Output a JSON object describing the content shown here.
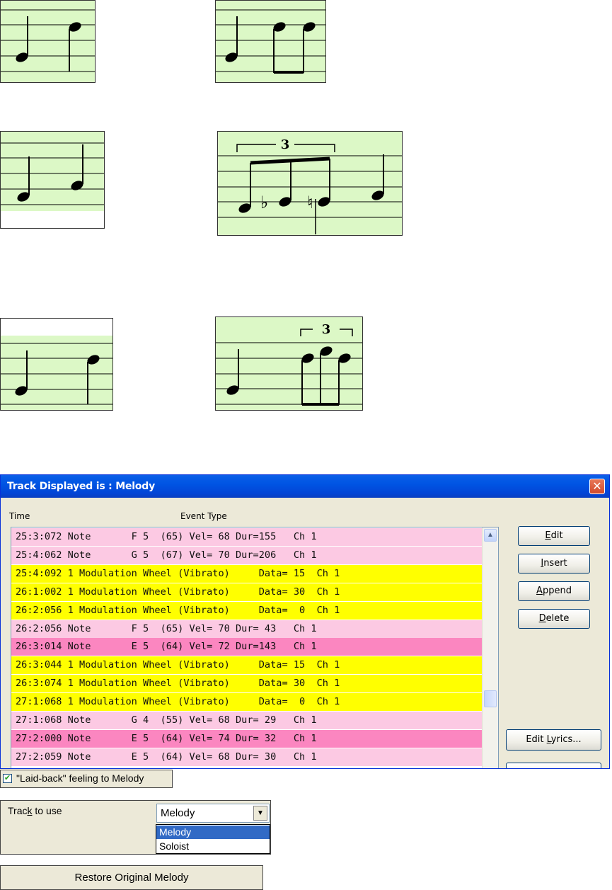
{
  "dialog": {
    "title": "Track Displayed is : Melody",
    "close_glyph": "✕",
    "headers": {
      "time": "Time",
      "event_type": "Event Type"
    },
    "rows": [
      {
        "text": "25:3:072 Note       F 5  (65) Vel= 68 Dur=155   Ch 1",
        "color": "#fcc9e3"
      },
      {
        "text": "25:4:062 Note       G 5  (67) Vel= 70 Dur=206   Ch 1",
        "color": "#fcc9e3"
      },
      {
        "text": "25:4:092 1 Modulation Wheel (Vibrato)     Data= 15  Ch 1",
        "color": "#ffff00"
      },
      {
        "text": "26:1:002 1 Modulation Wheel (Vibrato)     Data= 30  Ch 1",
        "color": "#ffff00"
      },
      {
        "text": "26:2:056 1 Modulation Wheel (Vibrato)     Data=  0  Ch 1",
        "color": "#ffff00"
      },
      {
        "text": "26:2:056 Note       F 5  (65) Vel= 70 Dur= 43   Ch 1",
        "color": "#fcc9e3"
      },
      {
        "text": "26:3:014 Note       E 5  (64) Vel= 72 Dur=143   Ch 1",
        "color": "#fb86c0"
      },
      {
        "text": "26:3:044 1 Modulation Wheel (Vibrato)     Data= 15  Ch 1",
        "color": "#ffff00"
      },
      {
        "text": "26:3:074 1 Modulation Wheel (Vibrato)     Data= 30  Ch 1",
        "color": "#ffff00"
      },
      {
        "text": "27:1:068 1 Modulation Wheel (Vibrato)     Data=  0  Ch 1",
        "color": "#ffff00"
      },
      {
        "text": "27:1:068 Note       G 4  (55) Vel= 68 Dur= 29   Ch 1",
        "color": "#fcc9e3"
      },
      {
        "text": "27:2:000 Note       E 5  (64) Vel= 74 Dur= 32   Ch 1",
        "color": "#fb86c0"
      },
      {
        "text": "27:2:059 Note       E 5  (64) Vel= 68 Dur= 30   Ch 1",
        "color": "#fcc9e3"
      }
    ],
    "buttons": {
      "edit": {
        "pre": "",
        "key": "E",
        "post": "dit"
      },
      "insert": {
        "pre": "",
        "key": "I",
        "post": "nsert"
      },
      "append": {
        "pre": "",
        "key": "A",
        "post": "ppend"
      },
      "delete": {
        "pre": "",
        "key": "D",
        "post": "elete"
      },
      "edit_lyrics": {
        "pre": "Edit ",
        "key": "L",
        "post": "yrics..."
      }
    }
  },
  "laidback": {
    "label": "\"Laid-back\" feeling to Melody",
    "checked": true,
    "check_glyph": "✔"
  },
  "track_panel": {
    "label_pre": "Trac",
    "label_key": "k",
    "label_post": " to use",
    "selected": "Melody",
    "options": [
      "Melody",
      "Soloist"
    ]
  },
  "restore_button": "Restore Original Melody",
  "colors": {
    "staff_bg": "#dcf8c6",
    "title_blue": "#0054e3",
    "note_pink": "#fcc9e3",
    "note_hot_pink": "#fb86c0",
    "controller_yellow": "#ffff00"
  },
  "music": {
    "triplet_mark": "3"
  }
}
